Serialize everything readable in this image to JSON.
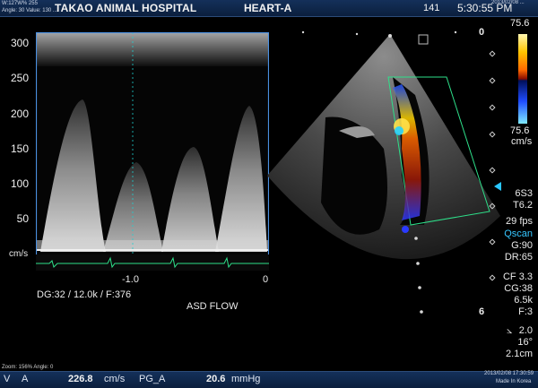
{
  "header": {
    "meta_line1": "W:127W% 255",
    "meta_line2": "Angle: 30 Value: 130   ...",
    "hospital": "TAKAO ANIMAL HOSPITAL",
    "preset": "HEART-A",
    "frame_number": "141",
    "time": "5:30:55 PM",
    "date_small": "2013/02/08 ..."
  },
  "doppler": {
    "y_ticks": [
      "300",
      "250",
      "200",
      "150",
      "100",
      "50",
      "cm/s"
    ],
    "baseline_marker": "-1.0",
    "x_zero": "0",
    "settings": "DG:32  / 12.0k  / F:376",
    "label": "ASD FLOW"
  },
  "scan": {
    "depth_top": "0",
    "depth_bottom": "6"
  },
  "color_bar": {
    "top_value": "75.6",
    "bottom_value": "75.6",
    "unit": "cm/s"
  },
  "params": {
    "probe": "6S3",
    "tissue": "T6.2",
    "fps": "29 fps",
    "qscan": "Qscan",
    "gain": "G:90",
    "dr": "DR:65",
    "cf": "CF 3.3",
    "cg": "CG:38",
    "prf": "6.5k",
    "filter": "F:3",
    "angle_value": "2.0",
    "angle": "16°",
    "depth": "2.1cm"
  },
  "footer": {
    "zoom": "Zoom: 156% Angle: 0",
    "mode": "A",
    "velocity_label": "V",
    "velocity": "226.8",
    "velocity_unit": "cm/s",
    "pg_label": "PG_A",
    "pg": "20.6",
    "pg_unit": "mmHg",
    "made_in": "Made In Korea",
    "date": "2013/02/08  17:30:59"
  }
}
